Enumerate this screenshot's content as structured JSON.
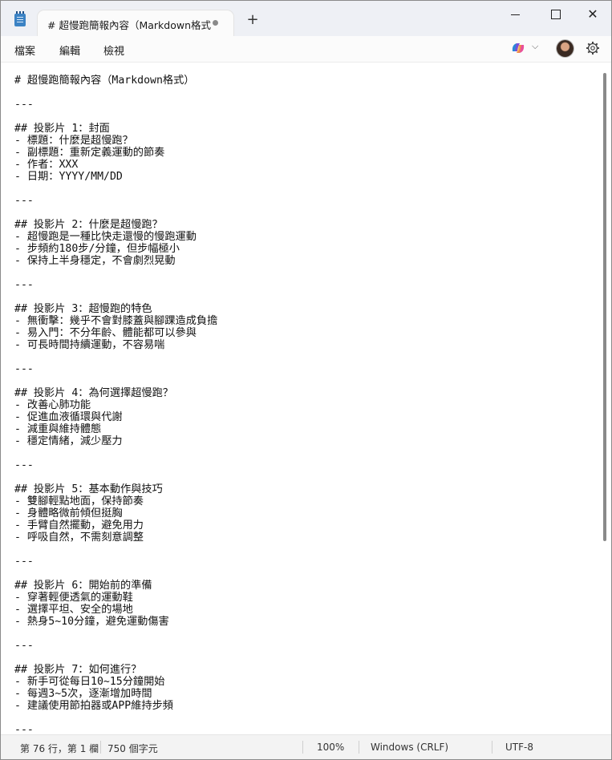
{
  "tab": {
    "title": "# 超慢跑簡報內容（Markdown格式"
  },
  "menu": {
    "file": "檔案",
    "edit": "編輯",
    "view": "檢視"
  },
  "editor": {
    "lines": [
      "# 超慢跑簡報內容（Markdown格式）",
      "",
      "---",
      "",
      "## 投影片 1：封面",
      "- 標題：什麼是超慢跑？",
      "- 副標題：重新定義運動的節奏",
      "- 作者：XXX",
      "- 日期：YYYY/MM/DD",
      "",
      "---",
      "",
      "## 投影片 2：什麼是超慢跑？",
      "- 超慢跑是一種比快走還慢的慢跑運動",
      "- 步頻約180步/分鐘，但步幅極小",
      "- 保持上半身穩定，不會劇烈晃動",
      "",
      "---",
      "",
      "## 投影片 3：超慢跑的特色",
      "- 無衝擊：幾乎不會對膝蓋與腳踝造成負擔",
      "- 易入門：不分年齡、體能都可以參與",
      "- 可長時間持續運動，不容易喘",
      "",
      "---",
      "",
      "## 投影片 4：為何選擇超慢跑？",
      "- 改善心肺功能",
      "- 促進血液循環與代謝",
      "- 減重與維持體態",
      "- 穩定情緒，減少壓力",
      "",
      "---",
      "",
      "## 投影片 5：基本動作與技巧",
      "- 雙腳輕點地面，保持節奏",
      "- 身體略微前傾但挺胸",
      "- 手臂自然擺動，避免用力",
      "- 呼吸自然，不需刻意調整",
      "",
      "---",
      "",
      "## 投影片 6：開始前的準備",
      "- 穿著輕便透氣的運動鞋",
      "- 選擇平坦、安全的場地",
      "- 熱身5~10分鐘，避免運動傷害",
      "",
      "---",
      "",
      "## 投影片 7：如何進行？",
      "- 新手可從每日10~15分鐘開始",
      "- 每週3~5次，逐漸增加時間",
      "- 建議使用節拍器或APP維持步頻",
      "",
      "---"
    ]
  },
  "status": {
    "position": "第 76 行，第 1 欄",
    "chars": "750 個字元",
    "zoom": "100%",
    "line_ending": "Windows (CRLF)",
    "encoding": "UTF-8"
  },
  "icons": {
    "app": "notepad-icon",
    "close_tab": "unsaved-dot-icon",
    "new_tab": "plus-icon",
    "minimize": "minimize-icon",
    "maximize": "maximize-icon",
    "close": "close-icon",
    "copilot": "copilot-icon",
    "dropdown": "chevron-down-icon",
    "settings": "gear-icon"
  }
}
